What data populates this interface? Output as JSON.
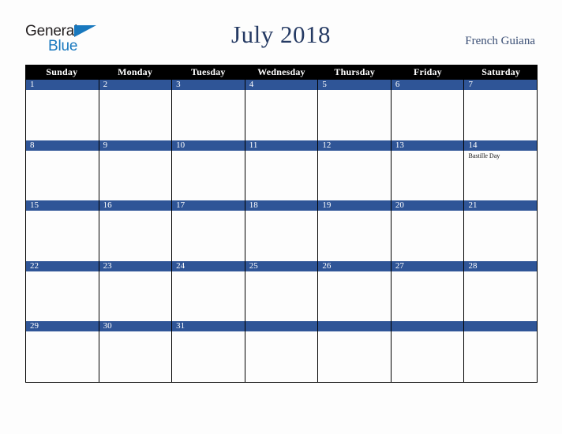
{
  "brand": {
    "name_part1": "General",
    "name_part2": "Blue",
    "triangle_icon": "triangle-icon",
    "color_dark": "#231f20",
    "color_blue": "#1878be"
  },
  "header": {
    "title": "July 2018",
    "country": "French Guiana"
  },
  "calendar": {
    "accent_color": "#2f5597",
    "header_bg": "#000000",
    "weekday_headers": [
      "Sunday",
      "Monday",
      "Tuesday",
      "Wednesday",
      "Thursday",
      "Friday",
      "Saturday"
    ],
    "weeks": [
      [
        {
          "day": "1",
          "events": []
        },
        {
          "day": "2",
          "events": []
        },
        {
          "day": "3",
          "events": []
        },
        {
          "day": "4",
          "events": []
        },
        {
          "day": "5",
          "events": []
        },
        {
          "day": "6",
          "events": []
        },
        {
          "day": "7",
          "events": []
        }
      ],
      [
        {
          "day": "8",
          "events": []
        },
        {
          "day": "9",
          "events": []
        },
        {
          "day": "10",
          "events": []
        },
        {
          "day": "11",
          "events": []
        },
        {
          "day": "12",
          "events": []
        },
        {
          "day": "13",
          "events": []
        },
        {
          "day": "14",
          "events": [
            "Bastille Day"
          ]
        }
      ],
      [
        {
          "day": "15",
          "events": []
        },
        {
          "day": "16",
          "events": []
        },
        {
          "day": "17",
          "events": []
        },
        {
          "day": "18",
          "events": []
        },
        {
          "day": "19",
          "events": []
        },
        {
          "day": "20",
          "events": []
        },
        {
          "day": "21",
          "events": []
        }
      ],
      [
        {
          "day": "22",
          "events": []
        },
        {
          "day": "23",
          "events": []
        },
        {
          "day": "24",
          "events": []
        },
        {
          "day": "25",
          "events": []
        },
        {
          "day": "26",
          "events": []
        },
        {
          "day": "27",
          "events": []
        },
        {
          "day": "28",
          "events": []
        }
      ],
      [
        {
          "day": "29",
          "events": []
        },
        {
          "day": "30",
          "events": []
        },
        {
          "day": "31",
          "events": []
        },
        {
          "day": "",
          "events": []
        },
        {
          "day": "",
          "events": []
        },
        {
          "day": "",
          "events": []
        },
        {
          "day": "",
          "events": []
        }
      ]
    ]
  }
}
